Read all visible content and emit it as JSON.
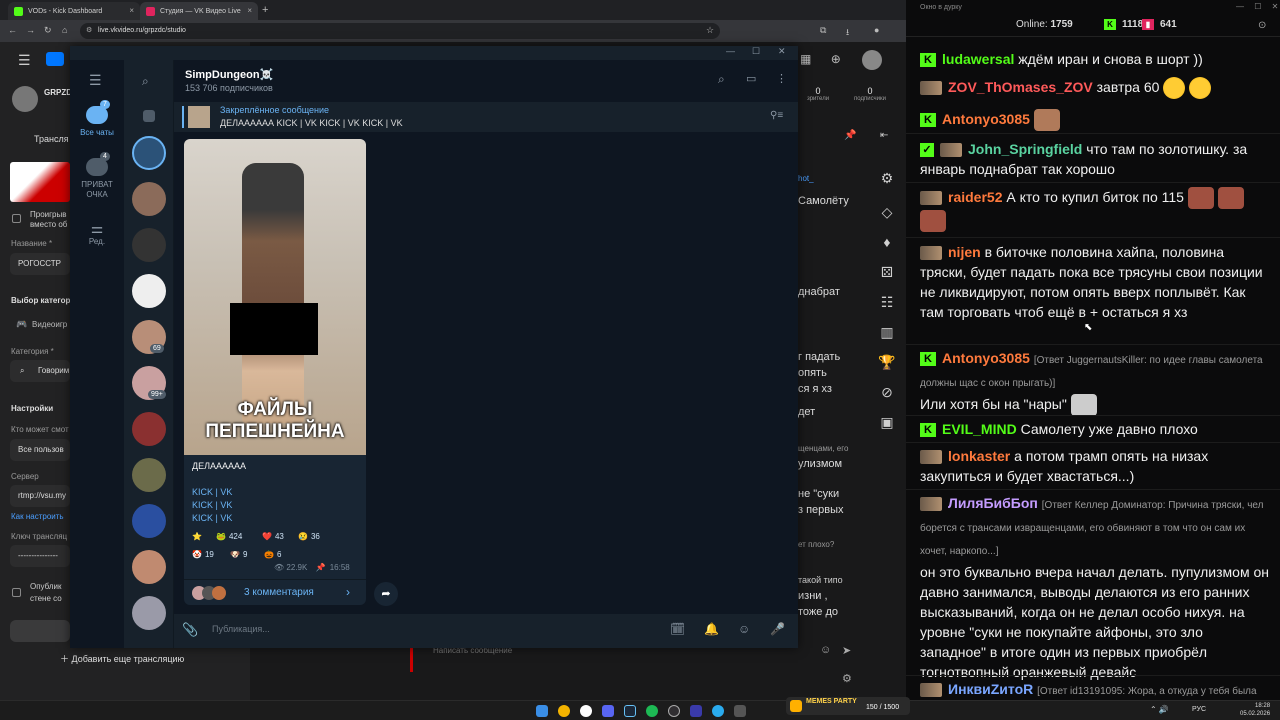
{
  "browser": {
    "tabs": [
      {
        "label": "VODs - Kick Dashboard",
        "color": "#53fc18"
      },
      {
        "label": "Студия — VK Видео Live",
        "color": "#e0245e"
      }
    ],
    "url": "live.vkvideo.ru/grpzdc/studio"
  },
  "vk": {
    "channel_short": "GRPZD",
    "left_items": {
      "broadcast_tab": "Трансля",
      "play_checkbox_label": "Проигрыв",
      "play_checkbox_label2": "вместо об",
      "name_label": "Название *",
      "name_value": "РОГОССТР",
      "category_choice_label": "Выбор категор",
      "category_game": "Видеоигр",
      "category_label": "Категория *",
      "category_value": "Говорим",
      "settings_title": "Настройки",
      "who_can_label": "Кто может смот",
      "who_can_value": "Все пользов",
      "server_label": "Сервер",
      "server_value": "rtmp://vsu.my",
      "how_to_link": "Как настроить",
      "key_label": "Ключ трансляц",
      "key_value": "---------------",
      "publish_label": "Опублик",
      "publish_label2": "стене со",
      "add_broadcast_button": "Добавить еще трансляцию"
    },
    "stats": [
      {
        "value": "0",
        "label": "зрители"
      },
      {
        "value": "0",
        "label": "подписчики"
      }
    ],
    "chat_fragments": [
      "Самолёту",
      "днабрат",
      "г падать",
      "опять",
      "ся я хз",
      "дет",
      "щенцами, его",
      "улизмом",
      "не \"суки",
      "з первых",
      "ет плохо?",
      "такой типо",
      "изни ,",
      "тоже до"
    ],
    "write_placeholder": "Написать сообщение",
    "stream_link_hint": "hot_"
  },
  "telegram": {
    "channel_name": "SimpDungeon☠️",
    "subscribers": "153 706 подписчиков",
    "folders": [
      {
        "label": "Все чаты",
        "badge": "7"
      },
      {
        "label": "ПРИВАТ ОЧКА",
        "badge": "4"
      },
      {
        "label": "Ред.",
        "badge": ""
      }
    ],
    "chat_badges": [
      "69",
      "99+"
    ],
    "pinned_title": "Закреплённое сообщение",
    "pinned_text": "ДЕЛАААААА  KICK | VK KICK | VK KICK | VK",
    "image_caption": "ФАЙЛЫ\nПЕПЕШНЕЙНА",
    "post_text": "ДЕЛАААААА",
    "post_links": [
      "KICK | VK",
      "KICK | VK",
      "KICK | VK"
    ],
    "reactions": [
      {
        "icon": "⭐",
        "count": ""
      },
      {
        "icon": "🐸",
        "count": "424"
      },
      {
        "icon": "❤️",
        "count": "43"
      },
      {
        "icon": "😢",
        "count": "36"
      },
      {
        "icon": "🤡",
        "count": "19"
      },
      {
        "icon": "🐶",
        "count": "9"
      },
      {
        "icon": "🎃",
        "count": "6"
      }
    ],
    "views": "22.9K",
    "time": "16:58",
    "comments": "3 комментария",
    "input_placeholder": "Публикация..."
  },
  "chat": {
    "window_title": "Окно в дурку",
    "online_label": "Online:",
    "online_value": "1759",
    "kick_count": "1118",
    "other_count": "641",
    "messages": [
      {
        "user": "ludawersal",
        "color": "#53fc18",
        "badge": "K",
        "text": "ждём иран и снова в шорт ))"
      },
      {
        "user": "ZOV_ThOmases_ZOV",
        "color": "#ff5a5a",
        "badge": "avatar",
        "text": "завтра 60"
      },
      {
        "user": "Antonyo3085",
        "color": "#ff7a3d",
        "badge": "K",
        "text": ""
      },
      {
        "user": "John_Springfield",
        "color": "#5ad3a0",
        "badge": "avatar",
        "text": "что там по золотишку. за январь поднабрат так хорошо"
      },
      {
        "user": "raider52",
        "color": "#ff7a3d",
        "badge": "avatar",
        "text": "А кто то купил биток  по 115"
      },
      {
        "user": "nijen",
        "color": "#ff7a3d",
        "badge": "avatar",
        "text": "в биточке половина хайпа, половина тряски, будет падать пока все трясуны свои позиции не ликвидируют, потом опять вверх поплывёт. Как там торговать чтоб ещё в + остаться я хз"
      },
      {
        "user": "Antonyo3085",
        "color": "#ff7a3d",
        "badge": "K",
        "reply": "[Ответ JuggernautsKiller: по идее главы самолета должны щас с окон прыгать)]",
        "text": "Или хотя бы на \"нары\""
      },
      {
        "user": "EVIL_MIND",
        "color": "#53fc18",
        "badge": "K",
        "text": "Самолету уже давно плохо"
      },
      {
        "user": "lonkaster",
        "color": "#ff7a3d",
        "badge": "avatar",
        "text": "а потом трамп опять на низах закупиться и будет хвастаться...)"
      },
      {
        "user": "ЛиляБибБоп",
        "color": "#c49cff",
        "badge": "avatar",
        "reply": "[Ответ Келлер Доминатор: Причина тряски, чел борется с трансами извращенцами, его обвиняют в том что он сам их хочет, наркопо...]",
        "text": "он это буквально вчера начал делать. пупулизмом он давно занимался, выводы делаются из его ранних высказываний, когда он не делал особо нихуя. на уровне \"суки не покупайте айфоны, это зло западное\" в итоге один из первых приобрёл тогнотвопный оранжевый девайс"
      },
      {
        "user": "ИнквиZитоR",
        "color": "#7aa6ff",
        "badge": "avatar",
        "reply": "[Ответ id13191095: Жора, а откуда у тебя была",
        "text": ""
      }
    ]
  },
  "taskbar": {
    "tray_text": "MEMES PARTY",
    "counter": "150 / 1500",
    "lang": "РУС",
    "time": "18:28",
    "date": "05.02.2026"
  },
  "colors": {
    "kick_green": "#53fc18",
    "telegram_link": "#6ab3f3",
    "bg_dark": "#0b0b0c"
  }
}
